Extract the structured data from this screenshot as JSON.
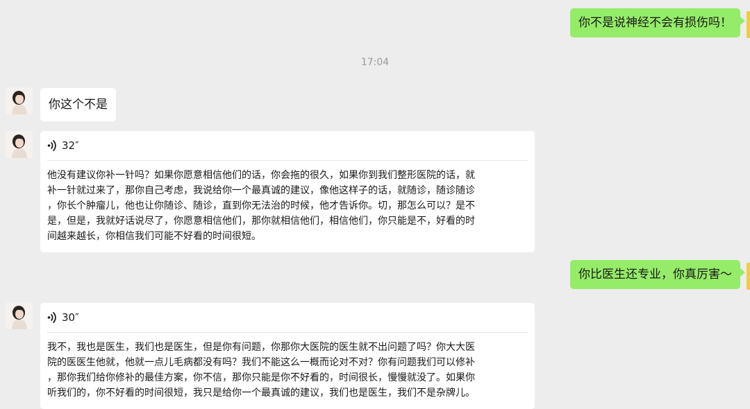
{
  "timestamp": "17:04",
  "messages": [
    {
      "from": "self",
      "text": "你不是说神经不会有损伤吗！"
    },
    {
      "from": "contact",
      "text": "你这个不是"
    },
    {
      "from": "contact",
      "type": "voice",
      "duration": "32″",
      "transcript_lines": [
        "他没有建议你补一针吗？如果你愿意相信他们的话，你会拖的很久，如果你到我们整形医院的话，就",
        "补一针就过来了，那你自己考虑，我说给你一个最真诚的建议，像他这样子的话，就随诊，随诊随诊",
        "，你长个肿瘤儿，他也让你随诊、随诊，直到你无法治的时候，他才告诉你。切，那怎么可以？是不",
        "是，但是，我就好话说尽了，你愿意相信他们，那你就相信他们，相信他们，你只能是不，好看的时",
        "间越来越长，你相信我们可能不好看的时间很短。"
      ]
    },
    {
      "from": "self",
      "text": "你比医生还专业，你真厉害～"
    },
    {
      "from": "contact",
      "type": "voice",
      "duration": "30″",
      "transcript_lines": [
        "我不，我也是医生，我们也是医生，但是你有问题，你那你大医院的医生就不出问题了吗？你大大医",
        "院的医医生他就，他就一点儿毛病都没有吗？我们不能这么一概而论对不对？你有问题我们可以修补",
        "，那你我们给你修补的最佳方案，你不信，那你只能是你不好看的，时间很长，慢慢就没了。如果你",
        "听我们的，你不好看的时间很短，我只是给你一个最真诚的建议，我们也是医生，我们不是杂牌儿。"
      ]
    }
  ],
  "colors": {
    "background": "#ededed",
    "self_bubble": "#95ec69",
    "contact_bubble": "#ffffff",
    "timestamp": "#9a9a9a"
  },
  "icons": [
    "contact-avatar",
    "voice-wave-icon",
    "self-avatar"
  ]
}
